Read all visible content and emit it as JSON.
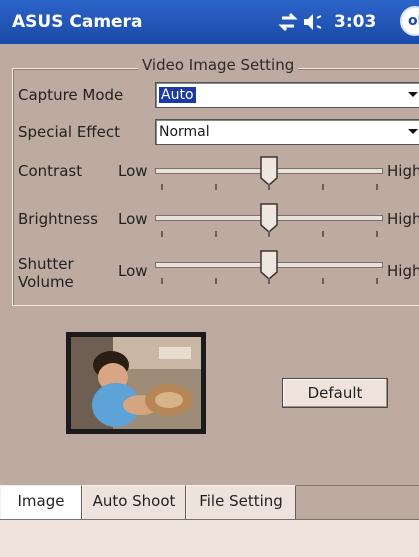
{
  "titlebar": {
    "app_title": "ASUS Camera",
    "clock": "3:03",
    "ok_label": "ok",
    "icons": [
      "connectivity-icon",
      "volume-icon"
    ]
  },
  "video_settings": {
    "group_title": "Video Image Setting",
    "capture_mode": {
      "label": "Capture Mode",
      "value": "Auto"
    },
    "special_effect": {
      "label": "Special Effect",
      "value": "Normal"
    },
    "sliders": [
      {
        "label": "Contrast",
        "low": "Low",
        "high": "High",
        "level": 0.5
      },
      {
        "label": "Brightness",
        "low": "Low",
        "high": "High",
        "level": 0.5
      },
      {
        "label_line1": "Shutter",
        "label_line2": "Volume",
        "low": "Low",
        "high": "High",
        "level": 0.5
      }
    ]
  },
  "preview": {
    "image": "camera-preview-image"
  },
  "default_button": {
    "label": "Default"
  },
  "tabs": [
    {
      "label": "Image",
      "active": true
    },
    {
      "label": "Auto Shoot",
      "active": false
    },
    {
      "label": "File Setting",
      "active": false
    }
  ],
  "colors": {
    "titlebar": "#1a4aa8",
    "background": "#bdaaa0",
    "selection": "#1a3aa8"
  }
}
